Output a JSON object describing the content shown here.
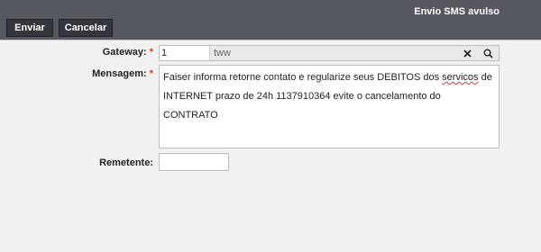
{
  "window": {
    "title": "Envio SMS avulso"
  },
  "toolbar": {
    "send_label": "Enviar",
    "cancel_label": "Cancelar"
  },
  "form": {
    "required_mark": "*",
    "gateway": {
      "label": "Gateway:",
      "id_value": "1",
      "name_value": "tww"
    },
    "message": {
      "label": "Mensagem:",
      "text_before": "Faiser informa retorne contato e regularize seus DEBITOS dos ",
      "misspelled_word": "servicos",
      "text_after": " de INTERNET prazo de 24h 1137910364 evite o cancelamento do CONTRATO"
    },
    "sender": {
      "label": "Remetente:",
      "value": ""
    }
  },
  "icons": {
    "clear": "close-icon",
    "search": "search-icon"
  },
  "colors": {
    "titlebar": "#55595f",
    "button": "#33373c",
    "required": "#d9362b"
  }
}
